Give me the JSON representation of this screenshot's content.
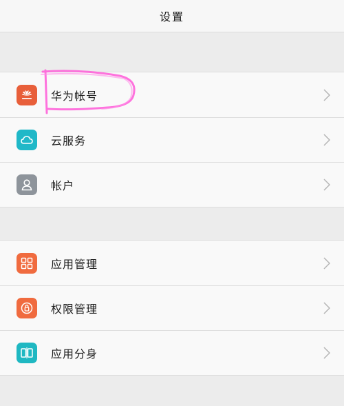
{
  "header": {
    "title": "设置"
  },
  "groups": [
    {
      "items": [
        {
          "label": "华为帐号",
          "icon": "huawei-logo-icon",
          "color": "#e85f3a"
        },
        {
          "label": "云服务",
          "icon": "cloud-icon",
          "color": "#20b8c8"
        },
        {
          "label": "帐户",
          "icon": "person-icon",
          "color": "#8e949b"
        }
      ]
    },
    {
      "items": [
        {
          "label": "应用管理",
          "icon": "apps-grid-icon",
          "color": "#f06b3f"
        },
        {
          "label": "权限管理",
          "icon": "lock-icon",
          "color": "#f06b3f"
        },
        {
          "label": "应用分身",
          "icon": "app-twin-icon",
          "color": "#1fb8c2"
        }
      ]
    }
  ],
  "colors": {
    "background": "#ececec",
    "row_background": "#f9f9f9",
    "highlight": "#ff5ad8",
    "chevron": "#b5b5b5"
  }
}
